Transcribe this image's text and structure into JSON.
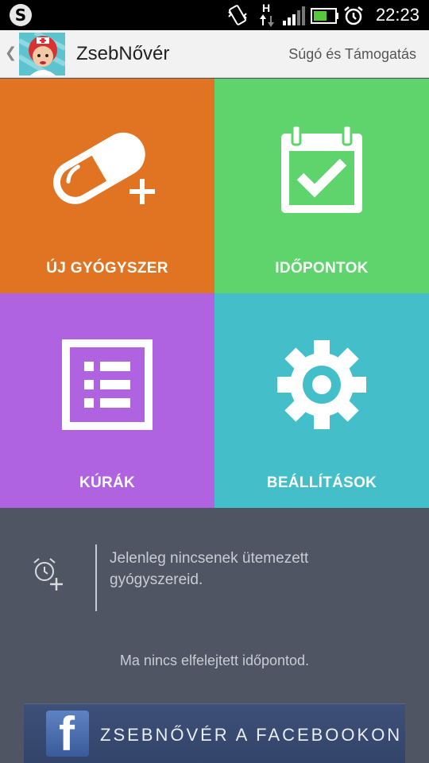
{
  "status_bar": {
    "time": "22:23",
    "icons": [
      "s-logo-icon",
      "vibrate-icon",
      "network-h-icon",
      "signal-icon",
      "battery-icon",
      "alarm-icon"
    ],
    "network_label": "H",
    "logo_letter": "S"
  },
  "action_bar": {
    "title": "ZsebNővér",
    "help_link": "Súgó és Támogatás",
    "back_glyph": "❮"
  },
  "tiles": [
    {
      "label": "ÚJ GYÓGYSZER",
      "icon": "pill-plus-icon",
      "color": "#e07422"
    },
    {
      "label": "IDŐPONTOK",
      "icon": "calendar-check-icon",
      "color": "#5fd46d"
    },
    {
      "label": "KÚRÁK",
      "icon": "list-icon",
      "color": "#b063e0"
    },
    {
      "label": "BEÁLLÍTÁSOK",
      "icon": "gear-icon",
      "color": "#44bfc9"
    }
  ],
  "bottom": {
    "empty_message": "Jelenleg nincsenek ütemezett gyógyszereid.",
    "forgot_message": "Ma nincs elfelejtett időpontod.",
    "facebook_label": "ZSEBNŐVÉR A FACEBOOKON",
    "facebook_logo_letter": "f"
  }
}
